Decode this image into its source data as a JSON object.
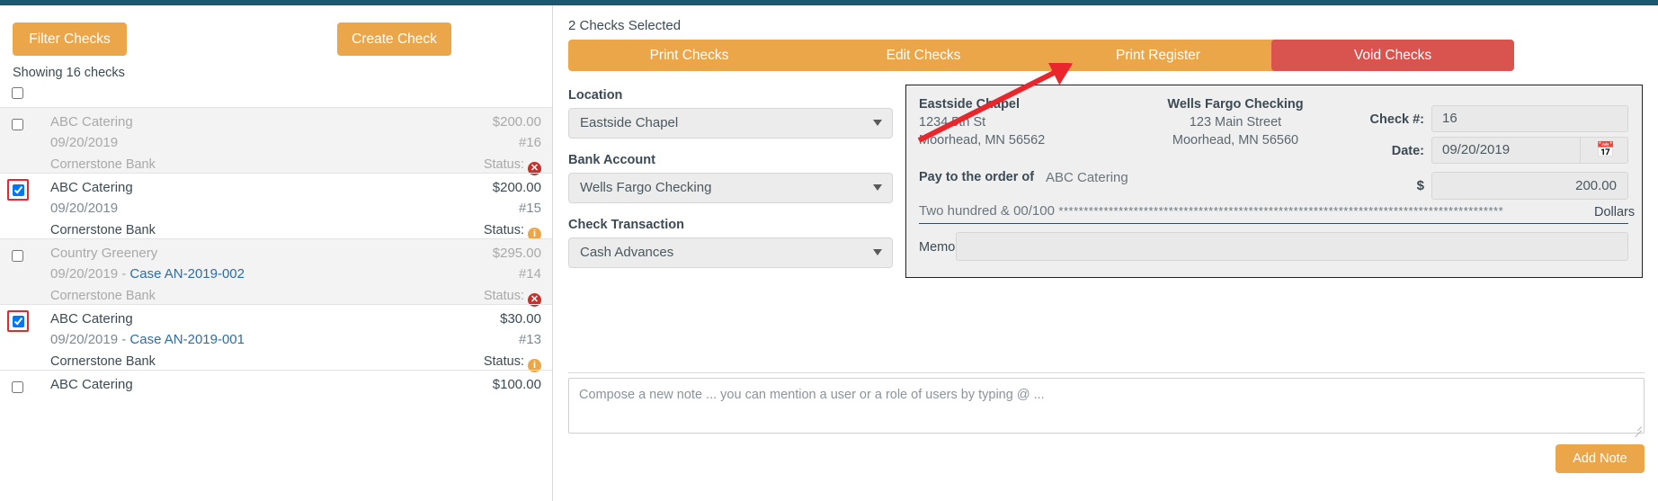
{
  "theme": {
    "topbar_color": "#1a5771",
    "accent_orange": "#eca64a",
    "danger_red": "#d9534f",
    "annotation_red": "#e8262c",
    "link_blue": "#2e6da4"
  },
  "left_panel": {
    "filter_button": "Filter Checks",
    "create_button": "Create Check",
    "showing_text": "Showing 16 checks",
    "status_label": "Status:",
    "checks": [
      {
        "payee": "ABC Catering",
        "date": "09/20/2019",
        "case": "",
        "amount": "$200.00",
        "number": "#16",
        "bank": "Cornerstone Bank",
        "status_icon": "error-circle-icon",
        "status_type": "err",
        "checked": false,
        "muted": true,
        "highlighted": false
      },
      {
        "payee": "ABC Catering",
        "date": "09/20/2019",
        "case": "",
        "amount": "$200.00",
        "number": "#15",
        "bank": "Cornerstone Bank",
        "status_icon": "info-circle-icon",
        "status_type": "info",
        "checked": true,
        "muted": false,
        "highlighted": true
      },
      {
        "payee": "Country Greenery",
        "date": "09/20/2019 - ",
        "case": "Case AN-2019-002",
        "amount": "$295.00",
        "number": "#14",
        "bank": "Cornerstone Bank",
        "status_icon": "error-circle-icon",
        "status_type": "err",
        "checked": false,
        "muted": true,
        "highlighted": false
      },
      {
        "payee": "ABC Catering",
        "date": "09/20/2019 - ",
        "case": "Case AN-2019-001",
        "amount": "$30.00",
        "number": "#13",
        "bank": "Cornerstone Bank",
        "status_icon": "info-circle-icon",
        "status_type": "info",
        "checked": true,
        "muted": false,
        "highlighted": true
      },
      {
        "payee": "ABC Catering",
        "date": "",
        "case": "",
        "amount": "$100.00",
        "number": "",
        "bank": "",
        "status_icon": "",
        "status_type": "",
        "checked": false,
        "muted": false,
        "highlighted": false
      }
    ]
  },
  "right_panel": {
    "selected_text": "2 Checks Selected",
    "actions": [
      {
        "label": "Print Checks",
        "style": "orange"
      },
      {
        "label": "Edit Checks",
        "style": "orange"
      },
      {
        "label": "Print Register",
        "style": "orange"
      },
      {
        "label": "Void Checks",
        "style": "red"
      }
    ],
    "form": {
      "location_label": "Location",
      "location_value": "Eastside Chapel",
      "bank_account_label": "Bank Account",
      "bank_account_value": "Wells Fargo Checking",
      "check_transaction_label": "Check Transaction",
      "check_transaction_value": "Cash Advances"
    },
    "check_preview": {
      "payer_name": "Eastside Chapel",
      "payer_address_line1": "1234 5th St",
      "payer_address_line2": "Moorhead, MN 56562",
      "bank_name": "Wells Fargo Checking",
      "bank_address_line1": "123 Main Street",
      "bank_address_line2": "Moorhead, MN 56560",
      "check_number_label": "Check #:",
      "check_number_value": "16",
      "date_label": "Date:",
      "date_value": "09/20/2019",
      "calendar_icon": "calendar-icon",
      "pay_to_label": "Pay to the order of",
      "payee_value": "ABC Catering",
      "dollar_symbol": "$",
      "amount_value": "200.00",
      "amount_words": "Two hundred & 00/100",
      "amount_stars": "*****************************************************************************************",
      "dollars_label": "Dollars",
      "memo_label": "Memo",
      "memo_value": ""
    },
    "note": {
      "placeholder": "Compose a new note ... you can mention a user or a role of users by typing @ ...",
      "value": "",
      "add_button": "Add Note"
    }
  }
}
